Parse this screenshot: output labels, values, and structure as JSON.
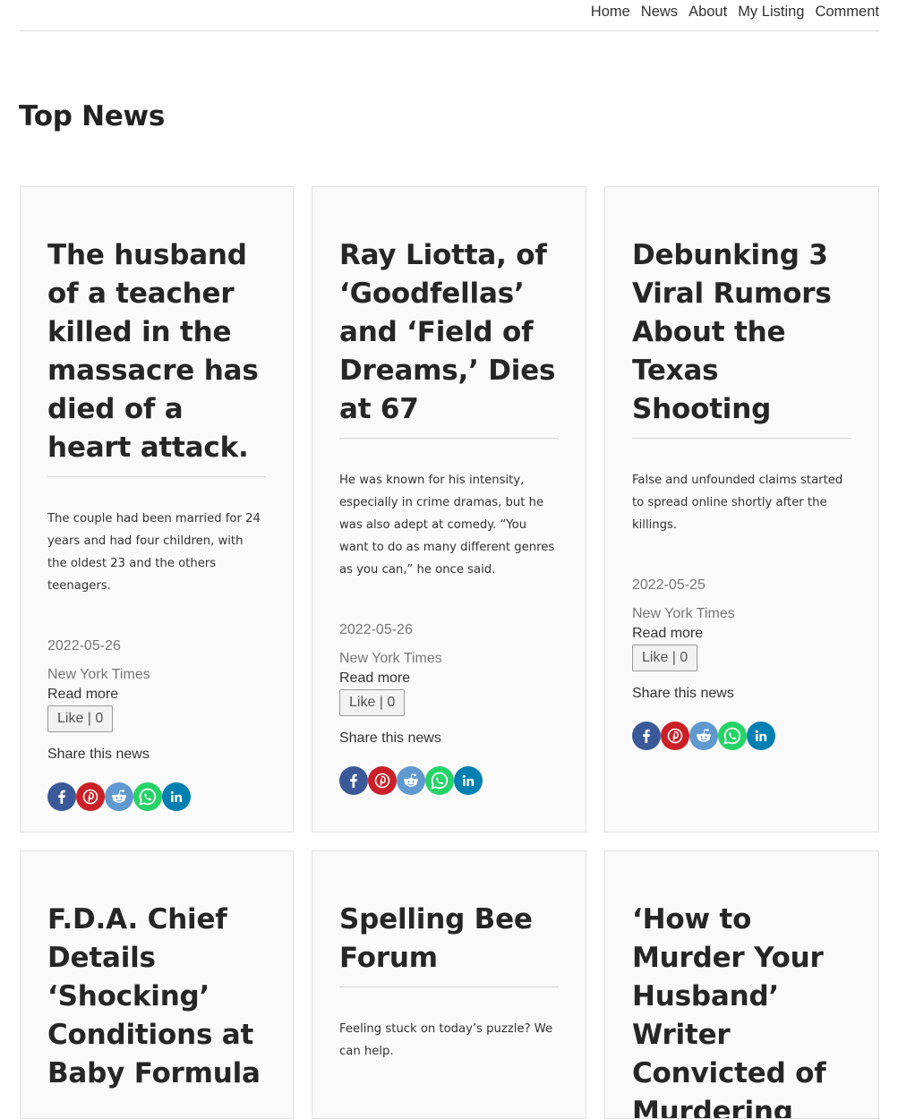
{
  "nav": {
    "items": [
      {
        "label": "Home"
      },
      {
        "label": "News"
      },
      {
        "label": "About"
      },
      {
        "label": "My Listing"
      },
      {
        "label": "Comment"
      }
    ]
  },
  "page": {
    "title": "Top News"
  },
  "colors": {
    "facebook": "#3b5998",
    "pinterest": "#cb2027",
    "reddit": "#5f99cf",
    "whatsapp": "#25d366",
    "linkedin": "#007fb1"
  },
  "share_icons": [
    "facebook-icon",
    "pinterest-icon",
    "reddit-icon",
    "whatsapp-icon",
    "linkedin-icon"
  ],
  "articles": [
    {
      "title": "The husband of a teacher killed in the massacre has died of a heart attack.",
      "description": "The couple had been married for 24 years and had four children, with the oldest 23 and the others teenagers.",
      "date": "2022-05-26",
      "source": "New York Times",
      "read_more": "Read more",
      "like_label": "Like | 0",
      "share_label": "Share this news"
    },
    {
      "title": "Ray Liotta, of ‘Goodfellas’ and ‘Field of Dreams,’ Dies at 67",
      "description": "He was known for his intensity, especially in crime dramas, but he was also adept at comedy. “You want to do as many different genres as you can,” he once said.",
      "date": "2022-05-26",
      "source": "New York Times",
      "read_more": "Read more",
      "like_label": "Like | 0",
      "share_label": "Share this news"
    },
    {
      "title": "Debunking 3 Viral Rumors About the Texas Shooting",
      "description": "False and unfounded claims started to spread online shortly after the killings.",
      "date": "2022-05-25",
      "source": "New York Times",
      "read_more": "Read more",
      "like_label": "Like | 0",
      "share_label": "Share this news"
    },
    {
      "title": "F.D.A. Chief Details ‘Shocking’ Conditions at Baby Formula",
      "description": "",
      "date": "",
      "source": "",
      "read_more": "",
      "like_label": "",
      "share_label": ""
    },
    {
      "title": "Spelling Bee Forum",
      "description": "Feeling stuck on today’s puzzle? We can help.",
      "date": "",
      "source": "",
      "read_more": "",
      "like_label": "",
      "share_label": ""
    },
    {
      "title": "‘How to Murder Your Husband’ Writer Convicted of Murdering",
      "description": "",
      "date": "",
      "source": "",
      "read_more": "",
      "like_label": "",
      "share_label": ""
    }
  ]
}
